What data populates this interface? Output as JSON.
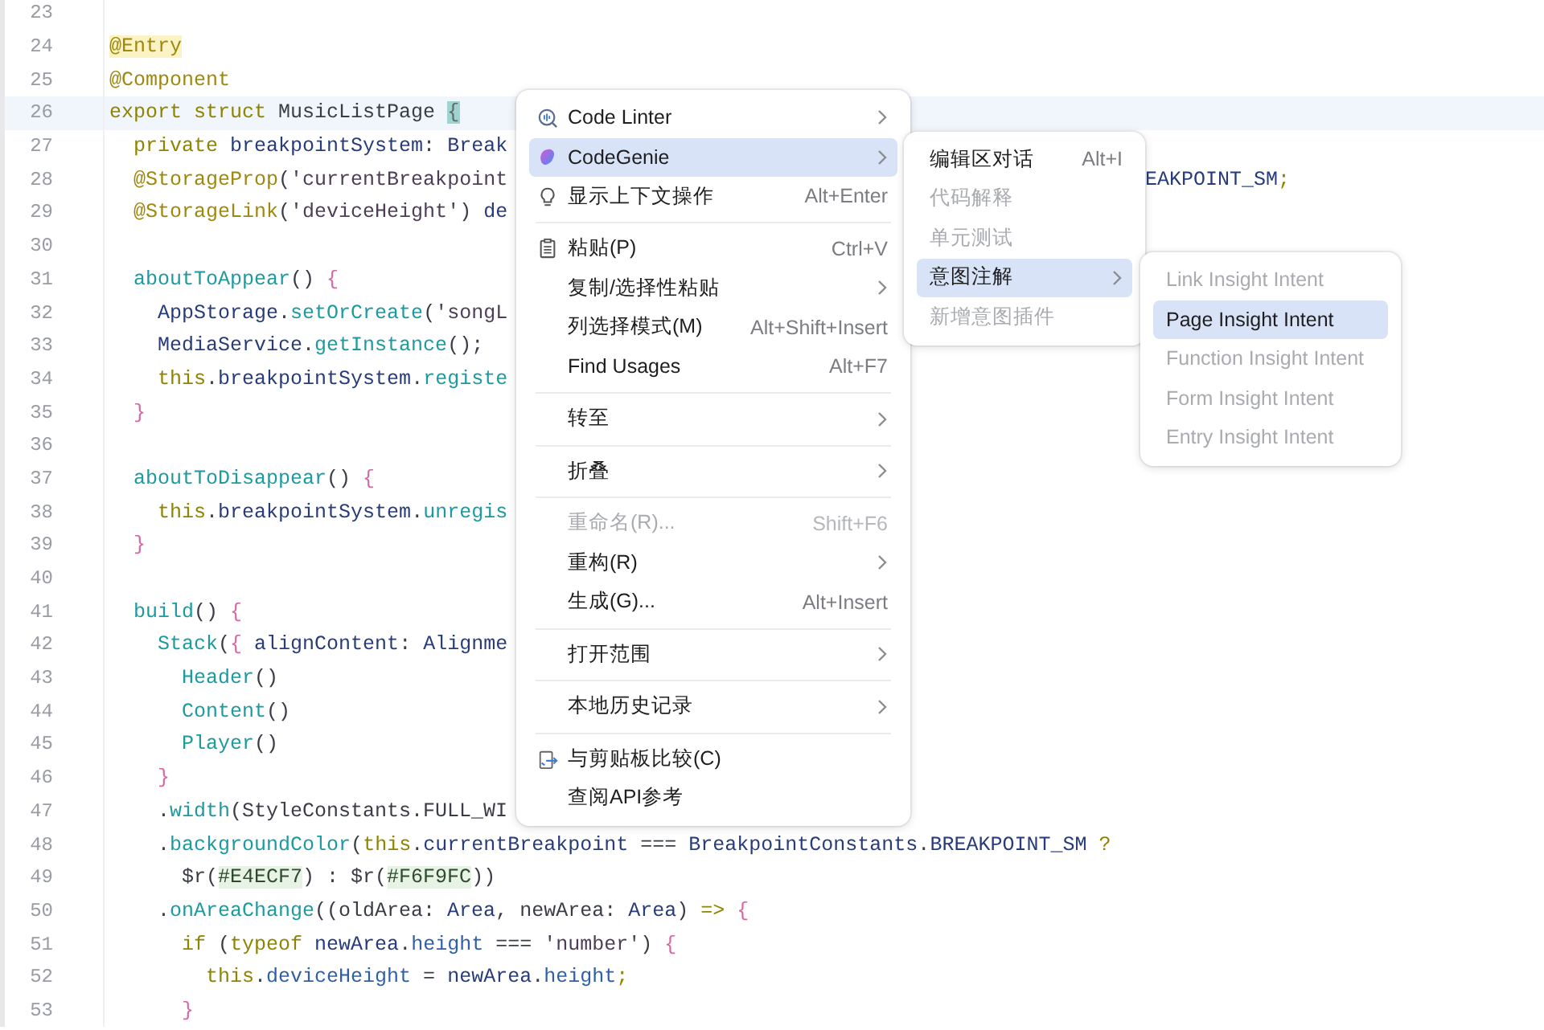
{
  "editor": {
    "lines": [
      {
        "number": "23",
        "current": false
      },
      {
        "number": "24",
        "current": false,
        "tokens": [
          {
            "kind": "ann-hl",
            "text": "@Entry"
          }
        ]
      },
      {
        "number": "25",
        "current": false,
        "tokens": [
          {
            "kind": "ann",
            "text": "@Component"
          }
        ]
      },
      {
        "number": "26",
        "current": true,
        "tokens": [
          {
            "kind": "kw",
            "text": "export struct "
          },
          {
            "kind": "plain",
            "text": "MusicListPage "
          },
          {
            "kind": "brace-match",
            "text": "{"
          }
        ]
      },
      {
        "number": "27",
        "current": false,
        "tokens": [
          {
            "kind": "kw",
            "text": "  private "
          },
          {
            "kind": "type",
            "text": "breakpointSystem"
          },
          {
            "kind": "plain",
            "text": ": "
          },
          {
            "kind": "type",
            "text": "Break"
          }
        ]
      },
      {
        "number": "28",
        "current": false,
        "tokens": [
          {
            "kind": "ann",
            "text": "  @StorageProp"
          },
          {
            "kind": "plain",
            "text": "("
          },
          {
            "kind": "str",
            "text": "'currentBreakpoint"
          }
        ],
        "tail": [
          {
            "kind": "type",
            "text": "EAKPOINT_SM"
          },
          {
            "kind": "kw",
            "text": ";"
          }
        ]
      },
      {
        "number": "29",
        "current": false,
        "tokens": [
          {
            "kind": "ann",
            "text": "  @StorageLink"
          },
          {
            "kind": "plain",
            "text": "("
          },
          {
            "kind": "str",
            "text": "'deviceHeight'"
          },
          {
            "kind": "plain",
            "text": ") "
          },
          {
            "kind": "type",
            "text": "de"
          }
        ]
      },
      {
        "number": "30",
        "current": false
      },
      {
        "number": "31",
        "current": false,
        "tokens": [
          {
            "kind": "fn",
            "text": "  aboutToAppear"
          },
          {
            "kind": "plain",
            "text": "() "
          },
          {
            "kind": "brace",
            "text": "{"
          }
        ]
      },
      {
        "number": "32",
        "current": false,
        "tokens": [
          {
            "kind": "type",
            "text": "    AppStorage"
          },
          {
            "kind": "plain",
            "text": "."
          },
          {
            "kind": "fn",
            "text": "setOrCreate"
          },
          {
            "kind": "plain",
            "text": "("
          },
          {
            "kind": "str",
            "text": "'songL"
          }
        ]
      },
      {
        "number": "33",
        "current": false,
        "tokens": [
          {
            "kind": "type",
            "text": "    MediaService"
          },
          {
            "kind": "plain",
            "text": "."
          },
          {
            "kind": "fn",
            "text": "getInstance"
          },
          {
            "kind": "plain",
            "text": "();"
          }
        ]
      },
      {
        "number": "34",
        "current": false,
        "tokens": [
          {
            "kind": "kw",
            "text": "    this"
          },
          {
            "kind": "plain",
            "text": "."
          },
          {
            "kind": "type",
            "text": "breakpointSystem"
          },
          {
            "kind": "plain",
            "text": "."
          },
          {
            "kind": "fn",
            "text": "registe"
          }
        ]
      },
      {
        "number": "35",
        "current": false,
        "tokens": [
          {
            "kind": "brace",
            "text": "  }"
          }
        ]
      },
      {
        "number": "36",
        "current": false
      },
      {
        "number": "37",
        "current": false,
        "tokens": [
          {
            "kind": "fn",
            "text": "  aboutToDisappear"
          },
          {
            "kind": "plain",
            "text": "() "
          },
          {
            "kind": "brace",
            "text": "{"
          }
        ]
      },
      {
        "number": "38",
        "current": false,
        "tokens": [
          {
            "kind": "kw",
            "text": "    this"
          },
          {
            "kind": "plain",
            "text": "."
          },
          {
            "kind": "type",
            "text": "breakpointSystem"
          },
          {
            "kind": "plain",
            "text": "."
          },
          {
            "kind": "fn",
            "text": "unregis"
          }
        ]
      },
      {
        "number": "39",
        "current": false,
        "tokens": [
          {
            "kind": "brace",
            "text": "  }"
          }
        ]
      },
      {
        "number": "40",
        "current": false
      },
      {
        "number": "41",
        "current": false,
        "tokens": [
          {
            "kind": "fn",
            "text": "  build"
          },
          {
            "kind": "plain",
            "text": "() "
          },
          {
            "kind": "brace",
            "text": "{"
          }
        ]
      },
      {
        "number": "42",
        "current": false,
        "tokens": [
          {
            "kind": "fn",
            "text": "    Stack"
          },
          {
            "kind": "plain",
            "text": "("
          },
          {
            "kind": "brace",
            "text": "{"
          },
          {
            "kind": "type",
            "text": " alignContent"
          },
          {
            "kind": "plain",
            "text": ": "
          },
          {
            "kind": "type",
            "text": "Alignme"
          }
        ]
      },
      {
        "number": "43",
        "current": false,
        "tokens": [
          {
            "kind": "fn",
            "text": "      Header"
          },
          {
            "kind": "plain",
            "text": "()"
          }
        ]
      },
      {
        "number": "44",
        "current": false,
        "tokens": [
          {
            "kind": "fn",
            "text": "      Content"
          },
          {
            "kind": "plain",
            "text": "()"
          }
        ]
      },
      {
        "number": "45",
        "current": false,
        "tokens": [
          {
            "kind": "fn",
            "text": "      Player"
          },
          {
            "kind": "plain",
            "text": "()"
          }
        ]
      },
      {
        "number": "46",
        "current": false,
        "tokens": [
          {
            "kind": "brace",
            "text": "    }"
          }
        ]
      },
      {
        "number": "47",
        "current": false,
        "tokens": [
          {
            "kind": "plain",
            "text": "    ."
          },
          {
            "kind": "fn",
            "text": "width"
          },
          {
            "kind": "plain",
            "text": "(StyleConstants.FULL_WI"
          }
        ]
      },
      {
        "number": "48",
        "current": false,
        "tokens": [
          {
            "kind": "plain",
            "text": "    ."
          },
          {
            "kind": "fn",
            "text": "backgroundColor"
          },
          {
            "kind": "plain",
            "text": "("
          },
          {
            "kind": "kw",
            "text": "this"
          },
          {
            "kind": "plain",
            "text": "."
          },
          {
            "kind": "type",
            "text": "currentBreakpoint"
          },
          {
            "kind": "plain",
            "text": " === "
          },
          {
            "kind": "type",
            "text": "BreakpointConstants"
          },
          {
            "kind": "plain",
            "text": "."
          },
          {
            "kind": "type",
            "text": "BREAKPOINT_SM"
          },
          {
            "kind": "kw",
            "text": " ?"
          }
        ]
      },
      {
        "number": "49",
        "current": false,
        "tokens": [
          {
            "kind": "plain",
            "text": "      $r("
          },
          {
            "kind": "hex-hl",
            "text": "#E4ECF7"
          },
          {
            "kind": "plain",
            "text": ") : $r("
          },
          {
            "kind": "hex-hl",
            "text": "#F6F9FC"
          },
          {
            "kind": "plain",
            "text": "))"
          }
        ]
      },
      {
        "number": "50",
        "current": false,
        "tokens": [
          {
            "kind": "plain",
            "text": "    ."
          },
          {
            "kind": "fn",
            "text": "onAreaChange"
          },
          {
            "kind": "plain",
            "text": "((oldArea: "
          },
          {
            "kind": "type",
            "text": "Area"
          },
          {
            "kind": "plain",
            "text": ", newArea: "
          },
          {
            "kind": "type",
            "text": "Area"
          },
          {
            "kind": "plain",
            "text": ") "
          },
          {
            "kind": "kw",
            "text": "=> "
          },
          {
            "kind": "brace",
            "text": "{"
          }
        ]
      },
      {
        "number": "51",
        "current": false,
        "tokens": [
          {
            "kind": "kw",
            "text": "      if "
          },
          {
            "kind": "plain",
            "text": "("
          },
          {
            "kind": "kw",
            "text": "typeof "
          },
          {
            "kind": "type",
            "text": "newArea"
          },
          {
            "kind": "plain",
            "text": "."
          },
          {
            "kind": "field",
            "text": "height"
          },
          {
            "kind": "plain",
            "text": " === "
          },
          {
            "kind": "str",
            "text": "'number'"
          },
          {
            "kind": "plain",
            "text": ") "
          },
          {
            "kind": "brace",
            "text": "{"
          }
        ]
      },
      {
        "number": "52",
        "current": false,
        "tokens": [
          {
            "kind": "kw",
            "text": "        this"
          },
          {
            "kind": "plain",
            "text": "."
          },
          {
            "kind": "field",
            "text": "deviceHeight"
          },
          {
            "kind": "plain",
            "text": " = "
          },
          {
            "kind": "type",
            "text": "newArea"
          },
          {
            "kind": "plain",
            "text": "."
          },
          {
            "kind": "field",
            "text": "height"
          },
          {
            "kind": "kw",
            "text": ";"
          }
        ]
      },
      {
        "number": "53",
        "current": false,
        "tokens": [
          {
            "kind": "brace",
            "text": "      }"
          }
        ]
      }
    ]
  },
  "context_menu": {
    "groups": [
      [
        {
          "kind": "linter",
          "label": "Code Linter",
          "submenu": true,
          "disabled": false,
          "selected": false
        },
        {
          "kind": "genie",
          "label": "CodeGenie",
          "submenu": true,
          "disabled": false,
          "selected": true
        },
        {
          "kind": "bulb",
          "label": "显示上下文操作",
          "shortcut": "Alt+Enter",
          "submenu": false,
          "disabled": false,
          "selected": false
        }
      ],
      [
        {
          "kind": "paste",
          "label": "粘贴(P)",
          "shortcut": "Ctrl+V",
          "submenu": false,
          "disabled": false,
          "selected": false
        },
        {
          "kind": "plain",
          "label": "复制/选择性粘贴",
          "submenu": true,
          "disabled": false,
          "selected": false
        },
        {
          "kind": "plain",
          "label": "列选择模式(M)",
          "shortcut": "Alt+Shift+Insert",
          "submenu": false,
          "disabled": false,
          "selected": false
        },
        {
          "kind": "plain",
          "label": "Find Usages",
          "shortcut": "Alt+F7",
          "submenu": false,
          "disabled": false,
          "selected": false
        }
      ],
      [
        {
          "kind": "plain",
          "label": "转至",
          "submenu": true,
          "disabled": false,
          "selected": false
        }
      ],
      [
        {
          "kind": "plain",
          "label": "折叠",
          "submenu": true,
          "disabled": false,
          "selected": false
        }
      ],
      [
        {
          "kind": "plain",
          "label": "重命名(R)...",
          "shortcut": "Shift+F6",
          "submenu": false,
          "disabled": true,
          "selected": false
        },
        {
          "kind": "plain",
          "label": "重构(R)",
          "submenu": true,
          "disabled": false,
          "selected": false
        },
        {
          "kind": "plain",
          "label": "生成(G)...",
          "shortcut": "Alt+Insert",
          "submenu": false,
          "disabled": false,
          "selected": false
        }
      ],
      [
        {
          "kind": "plain",
          "label": "打开范围",
          "submenu": true,
          "disabled": false,
          "selected": false
        }
      ],
      [
        {
          "kind": "plain",
          "label": "本地历史记录",
          "submenu": true,
          "disabled": false,
          "selected": false
        }
      ],
      [
        {
          "kind": "compare",
          "label": "与剪贴板比较(C)",
          "submenu": false,
          "disabled": false,
          "selected": false
        },
        {
          "kind": "plain",
          "label": "查阅API参考",
          "submenu": false,
          "disabled": false,
          "selected": false
        }
      ]
    ]
  },
  "codegenie_submenu": {
    "items": [
      {
        "label": "编辑区对话",
        "shortcut": "Alt+I",
        "submenu": false,
        "disabled": false,
        "selected": false
      },
      {
        "label": "代码解释",
        "submenu": false,
        "disabled": true,
        "selected": false
      },
      {
        "label": "单元测试",
        "submenu": false,
        "disabled": true,
        "selected": false
      },
      {
        "label": "意图注解",
        "submenu": true,
        "disabled": false,
        "selected": true
      },
      {
        "label": "新增意图插件",
        "submenu": false,
        "disabled": true,
        "selected": false
      }
    ]
  },
  "intent_submenu": {
    "items": [
      {
        "label": "Link Insight Intent",
        "submenu": false,
        "disabled": true,
        "selected": false
      },
      {
        "label": "Page Insight Intent",
        "submenu": false,
        "disabled": false,
        "selected": true
      },
      {
        "label": "Function Insight Intent",
        "submenu": false,
        "disabled": true,
        "selected": false
      },
      {
        "label": "Form Insight Intent",
        "submenu": false,
        "disabled": true,
        "selected": false
      },
      {
        "label": "Entry Insight Intent",
        "submenu": false,
        "disabled": true,
        "selected": false
      }
    ]
  }
}
